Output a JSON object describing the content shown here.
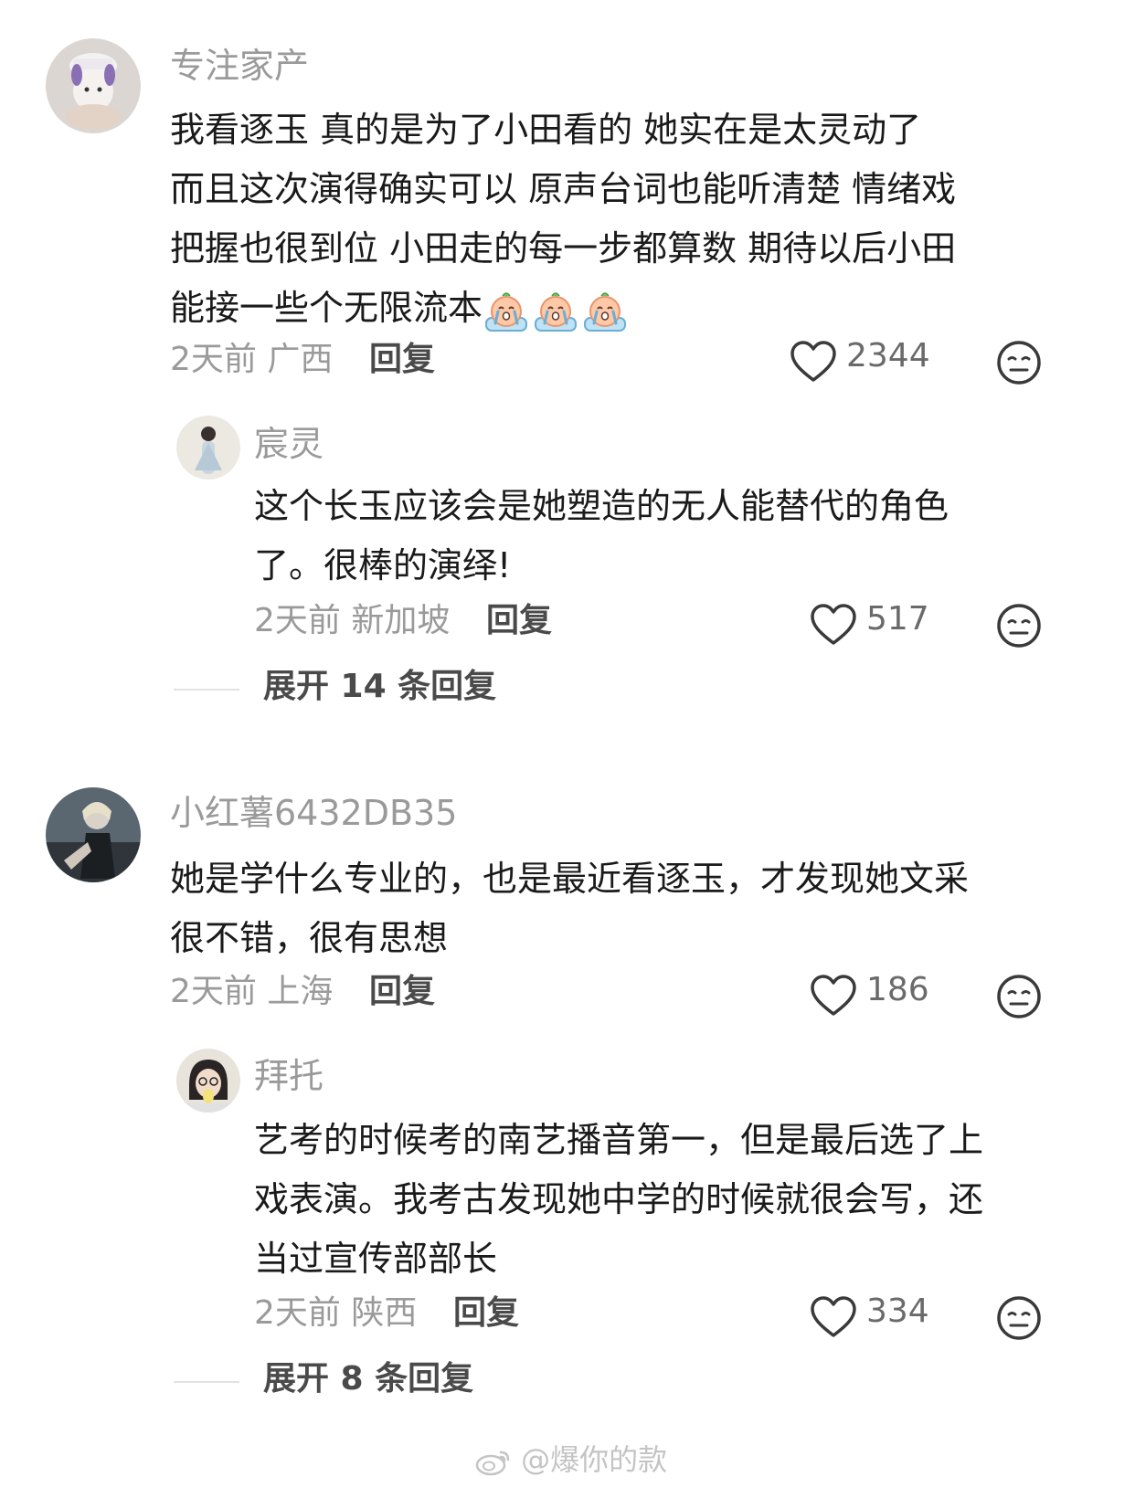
{
  "comments": [
    {
      "username": "专注家产",
      "lines": [
        "我看逐玉  真的是为了小田看的  她实在是太灵动了",
        "而且这次演得确实可以  原声台词也能听清楚   情绪戏",
        "把握也很到位  小田走的每一步都算数  期待以后小田",
        "能接一些个无限流本"
      ],
      "emojis": [
        "crying-emoji",
        "crying-emoji",
        "crying-emoji"
      ],
      "time_location": "2天前 广西",
      "reply_label": "回复",
      "likes": "2344",
      "reply": {
        "username": "宸灵",
        "lines": [
          "这个长玉应该会是她塑造的无人能替代的角色",
          "了。很棒的演绎!"
        ],
        "time_location": "2天前 新加坡",
        "reply_label": "回复",
        "likes": "517"
      },
      "expand_label": "展开 14 条回复"
    },
    {
      "username": "小红薯6432DB35",
      "lines": [
        "她是学什么专业的，也是最近看逐玉，才发现她文采",
        "很不错，很有思想"
      ],
      "time_location": "2天前 上海",
      "reply_label": "回复",
      "likes": "186",
      "reply": {
        "username": "拜托",
        "lines": [
          "艺考的时候考的南艺播音第一，但是最后选了上",
          "戏表演。我考古发现她中学的时候就很会写，还",
          "当过宣传部部长"
        ],
        "time_location": "2天前 陕西",
        "reply_label": "回复",
        "likes": "334"
      },
      "expand_label": "展开 8 条回复"
    }
  ],
  "watermark": "@爆你的款",
  "icons": {
    "like": "heart-outline-icon",
    "dislike": "meh-face-icon",
    "watermark": "weibo-logo-icon"
  },
  "colors": {
    "username": "#9a9a9a",
    "text": "#1a1a1a",
    "meta": "#9a9a9a"
  }
}
